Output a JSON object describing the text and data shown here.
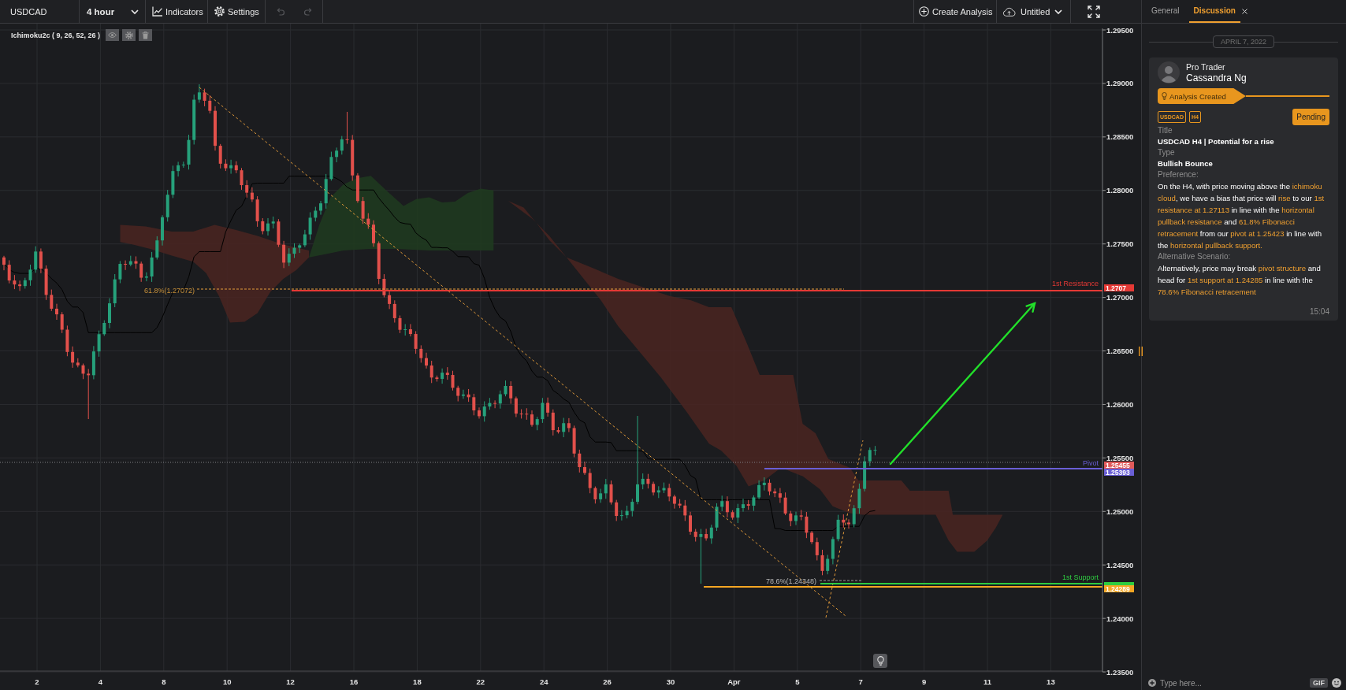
{
  "toolbar": {
    "symbol": "USDCAD",
    "timeframe": "4 hour",
    "buttons": [
      {
        "kind": "indicators",
        "label": "Indicators"
      },
      {
        "kind": "settings",
        "label": "Settings"
      }
    ],
    "history": [
      {
        "kind": "undo",
        "disabled": true
      },
      {
        "kind": "redo",
        "disabled": true
      }
    ],
    "actions": [
      {
        "kind": "create",
        "label": "Create Analysis"
      },
      {
        "kind": "save",
        "label": "Untitled"
      }
    ]
  },
  "chart": {
    "indicator": {
      "label": "Ichimoku2c ( 9, 26, 52, 26 )"
    },
    "price_axis": [
      "1.29500",
      "1.29000",
      "1.28500",
      "1.28000",
      "1.27500",
      "1.27000",
      "1.26500",
      "1.26000",
      "1.25500",
      "1.25000",
      "1.24500",
      "1.24000",
      "1.23500"
    ],
    "date_axis": [
      "2",
      "4",
      "8",
      "10",
      "12",
      "16",
      "18",
      "22",
      "24",
      "26",
      "30",
      "Apr",
      "5",
      "7",
      "9",
      "11",
      "13"
    ],
    "levels": [
      {
        "label": "1st Resistance",
        "tag": "1.2707",
        "color": "#e53935"
      },
      {
        "label": "Pivot",
        "tag": "1.25393",
        "color": "#6a5fd6"
      },
      {
        "label": "1st Support",
        "color": "#2ecc40"
      },
      {
        "tag": "1.24289",
        "color": "#f5a623"
      }
    ],
    "current_price": "1.25455",
    "fib_levels": [
      {
        "label": "61.8%(1.27072)"
      },
      {
        "label": "78.6%(1.24348)"
      }
    ]
  },
  "panel": {
    "tabs": [
      {
        "label": "General",
        "selected": false
      },
      {
        "label": "Discussion",
        "selected": true
      }
    ],
    "date": "APRIL 7, 2022",
    "post": {
      "role": "Pro Trader",
      "author": "Cassandra Ng",
      "event": "Analysis Created",
      "tags": [
        "USDCAD",
        "H4"
      ],
      "status": "Pending",
      "fields": [
        {
          "label": "Title",
          "kind": "value",
          "segments": [
            {
              "text": "USDCAD H4 | Potential for a rise",
              "highlighted": false
            }
          ]
        },
        {
          "label": "Type",
          "kind": "value",
          "segments": [
            {
              "text": "Bullish Bounce",
              "highlighted": false
            }
          ]
        },
        {
          "label": "Preference:",
          "kind": "paragraph",
          "segments": [
            {
              "text": "On the H4, with price moving above the ",
              "highlighted": false
            },
            {
              "text": "ichimoku cloud",
              "highlighted": true
            },
            {
              "text": ", we have a bias that price will ",
              "highlighted": false
            },
            {
              "text": "rise",
              "highlighted": true
            },
            {
              "text": " to our ",
              "highlighted": false
            },
            {
              "text": "1st resistance at 1.27113",
              "highlighted": true
            },
            {
              "text": " in line with the ",
              "highlighted": false
            },
            {
              "text": "horizontal pullback resistance",
              "highlighted": true
            },
            {
              "text": " and ",
              "highlighted": false
            },
            {
              "text": "61.8% Fibonacci retracement",
              "highlighted": true
            },
            {
              "text": " from our ",
              "highlighted": false
            },
            {
              "text": "pivot at 1.25423",
              "highlighted": true
            },
            {
              "text": " in line with the ",
              "highlighted": false
            },
            {
              "text": "horizontal pullback support.",
              "highlighted": true
            }
          ]
        },
        {
          "label": "Alternative Scenario:",
          "kind": "paragraph",
          "segments": [
            {
              "text": "Alternatively, price may break ",
              "highlighted": false
            },
            {
              "text": "pivot structure",
              "highlighted": true
            },
            {
              "text": " and head for ",
              "highlighted": false
            },
            {
              "text": "1st support at 1.24285",
              "highlighted": true
            },
            {
              "text": " in line with the ",
              "highlighted": false
            },
            {
              "text": "78.6% Fibonacci retracement",
              "highlighted": true
            }
          ]
        }
      ],
      "time": "15:04"
    },
    "composer": {
      "placeholder": "Type here...",
      "gif": "GIF"
    }
  }
}
